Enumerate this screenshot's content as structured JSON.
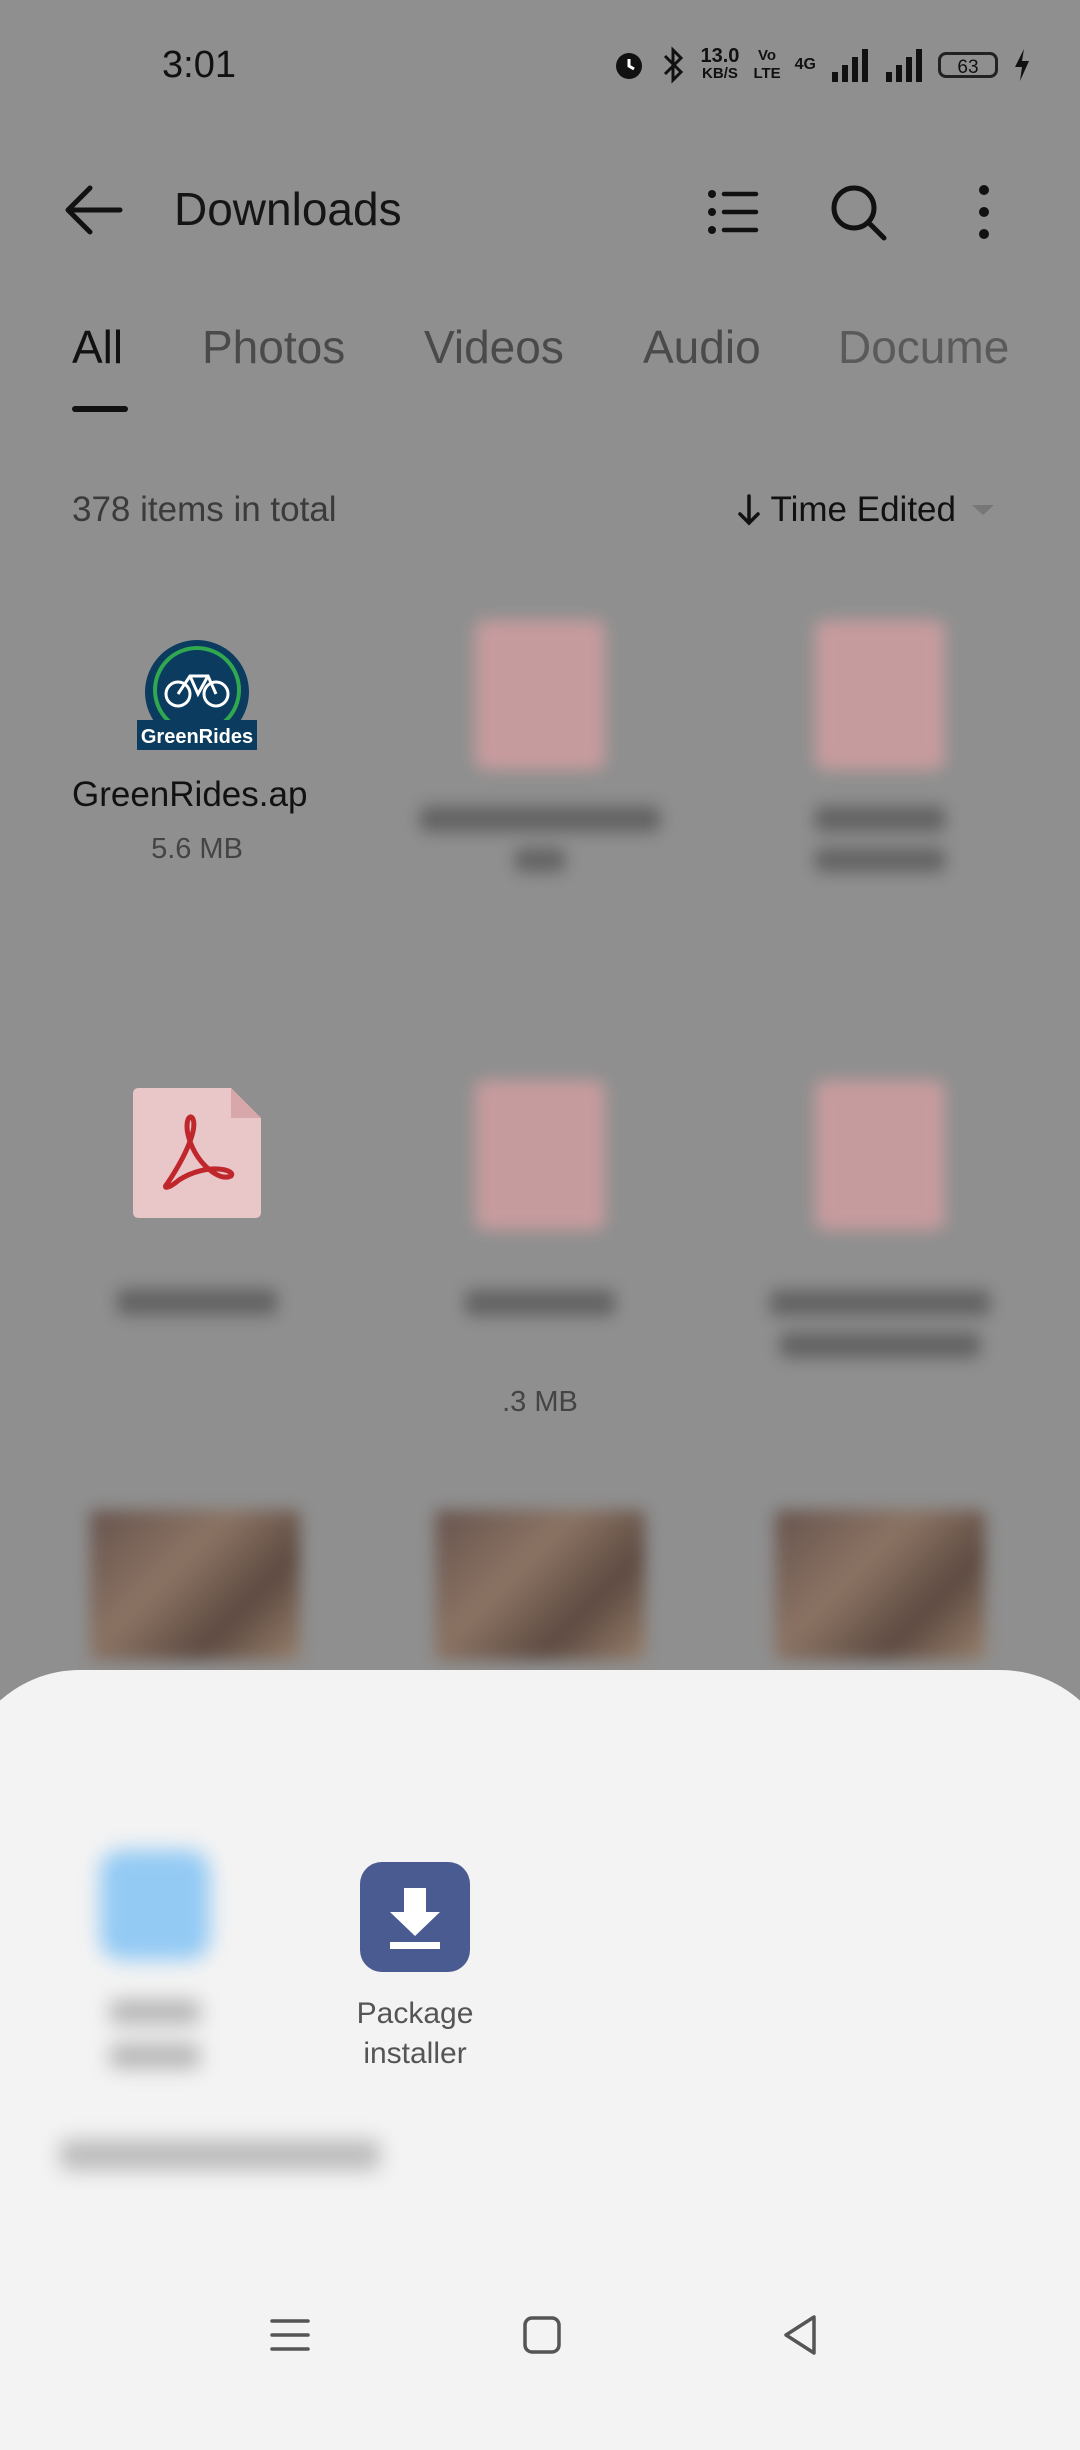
{
  "status_bar": {
    "time": "3:01",
    "net_speed_value": "13.0",
    "net_speed_unit": "KB/S",
    "volte_top": "Vo",
    "volte_bottom": "LTE",
    "network": "4G",
    "battery": "63",
    "icons": [
      "alarm-icon",
      "bluetooth-icon",
      "signal-icon",
      "signal-icon",
      "battery-icon",
      "charging-icon"
    ]
  },
  "toolbar": {
    "title": "Downloads",
    "icons": [
      "back-arrow-icon",
      "list-view-icon",
      "search-icon",
      "more-options-icon"
    ]
  },
  "tabs": [
    {
      "label": "All",
      "active": true
    },
    {
      "label": "Photos"
    },
    {
      "label": "Videos"
    },
    {
      "label": "Audio"
    },
    {
      "label": "Docume"
    }
  ],
  "summary": {
    "count_text": "378 items in total",
    "sort_label": "Time Edited"
  },
  "files": [
    {
      "name": "GreenRides.ap",
      "size": "5.6 MB",
      "logo_text": "GreenRides"
    },
    {
      "name": "",
      "size": ".3 MB"
    }
  ],
  "share_sheet": {
    "apps": [
      {
        "label_line1": "Package",
        "label_line2": "installer",
        "icon": "download-icon"
      }
    ]
  },
  "nav_bar": {
    "icons": [
      "menu-icon",
      "home-square-icon",
      "back-triangle-icon"
    ]
  },
  "colors": {
    "accent": "#4a5b92",
    "dim_overlay": "#8f8f8f",
    "sheet": "#f3f3f3",
    "pdf_red": "#c0272d"
  }
}
